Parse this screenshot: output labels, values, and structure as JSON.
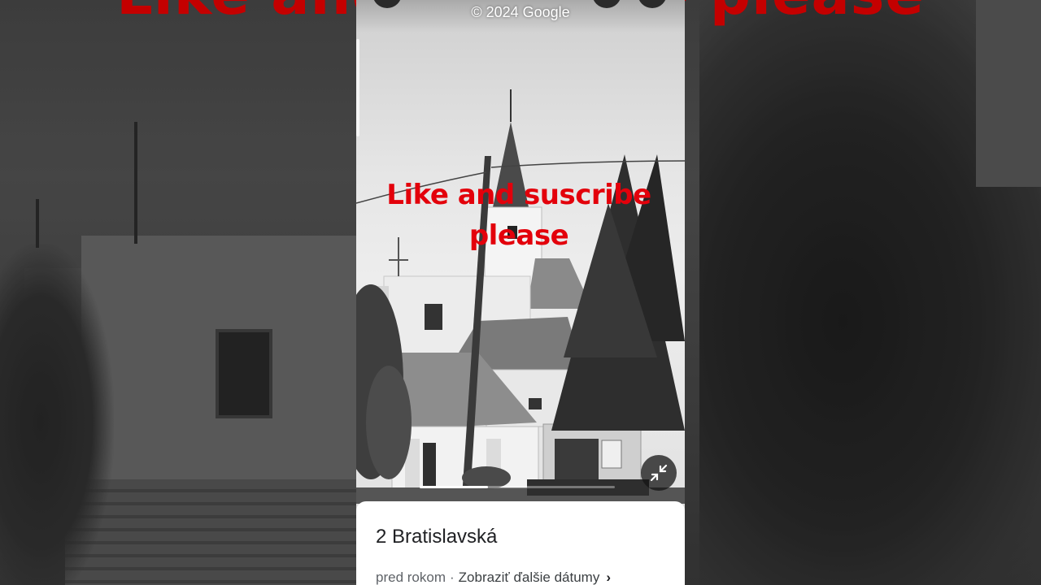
{
  "overlay": {
    "banner_text": "Like and suscribe please",
    "text_color": "#e3000b"
  },
  "viewer": {
    "copyright": "© 2024 Google",
    "minimize_icon": "exit-fullscreen-icon",
    "progress_fraction": 0.35
  },
  "card": {
    "title": "2 Bratislavská",
    "date_text": "pred rokom",
    "separator": "·",
    "more_dates_label": "Zobraziť ďalšie dátumy",
    "chevron_icon": "chevron-right-icon"
  }
}
